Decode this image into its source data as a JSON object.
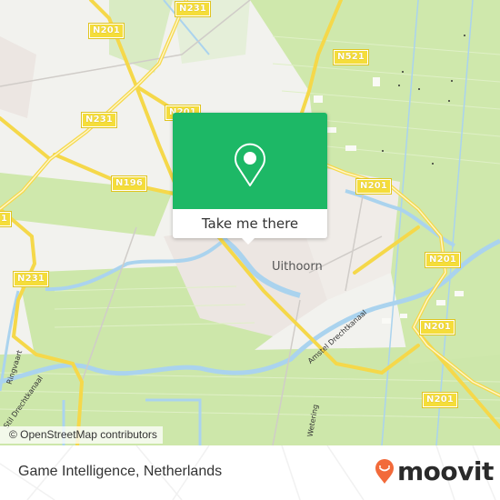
{
  "map": {
    "road_labels": [
      {
        "label": "N231",
        "id": "n231-top"
      },
      {
        "label": "N201",
        "id": "n201-top-left"
      },
      {
        "label": "N521",
        "id": "n521"
      },
      {
        "label": "N231",
        "id": "n231-mid"
      },
      {
        "label": "N201",
        "id": "n201-mid"
      },
      {
        "label": "N196",
        "id": "n196"
      },
      {
        "label": "N201",
        "id": "n201-right-1"
      },
      {
        "label": "N201",
        "id": "n201-right-2"
      },
      {
        "label": "N201",
        "id": "n201-right-3"
      },
      {
        "label": "N201",
        "id": "n201-right-4"
      },
      {
        "label": "N231",
        "id": "n231-left"
      },
      {
        "label": "1",
        "id": "edge-left"
      }
    ],
    "place_label": "Uithoorn",
    "street_labels": {
      "ringvaart": "Ringvaart",
      "drechtkanaal_left": "Stil Drechtkanaal",
      "amstel_drechtkanaal": "Amstel Drechtkanaal",
      "wetering": "Wetering"
    },
    "attribution": "© OpenStreetMap contributors"
  },
  "popup": {
    "icon": "location-pin-icon",
    "action_label": "Take me there"
  },
  "footer": {
    "title": "Game Intelligence, Netherlands",
    "logo_text": "moovit",
    "logo_icon": "moovit-smile-pin-icon",
    "brand_color": "#f26a3a"
  },
  "colors": {
    "popup_green": "#1db866",
    "road_yellow": "#f7dc5a",
    "water": "#aad3ee",
    "meadow": "#cde8a8"
  }
}
